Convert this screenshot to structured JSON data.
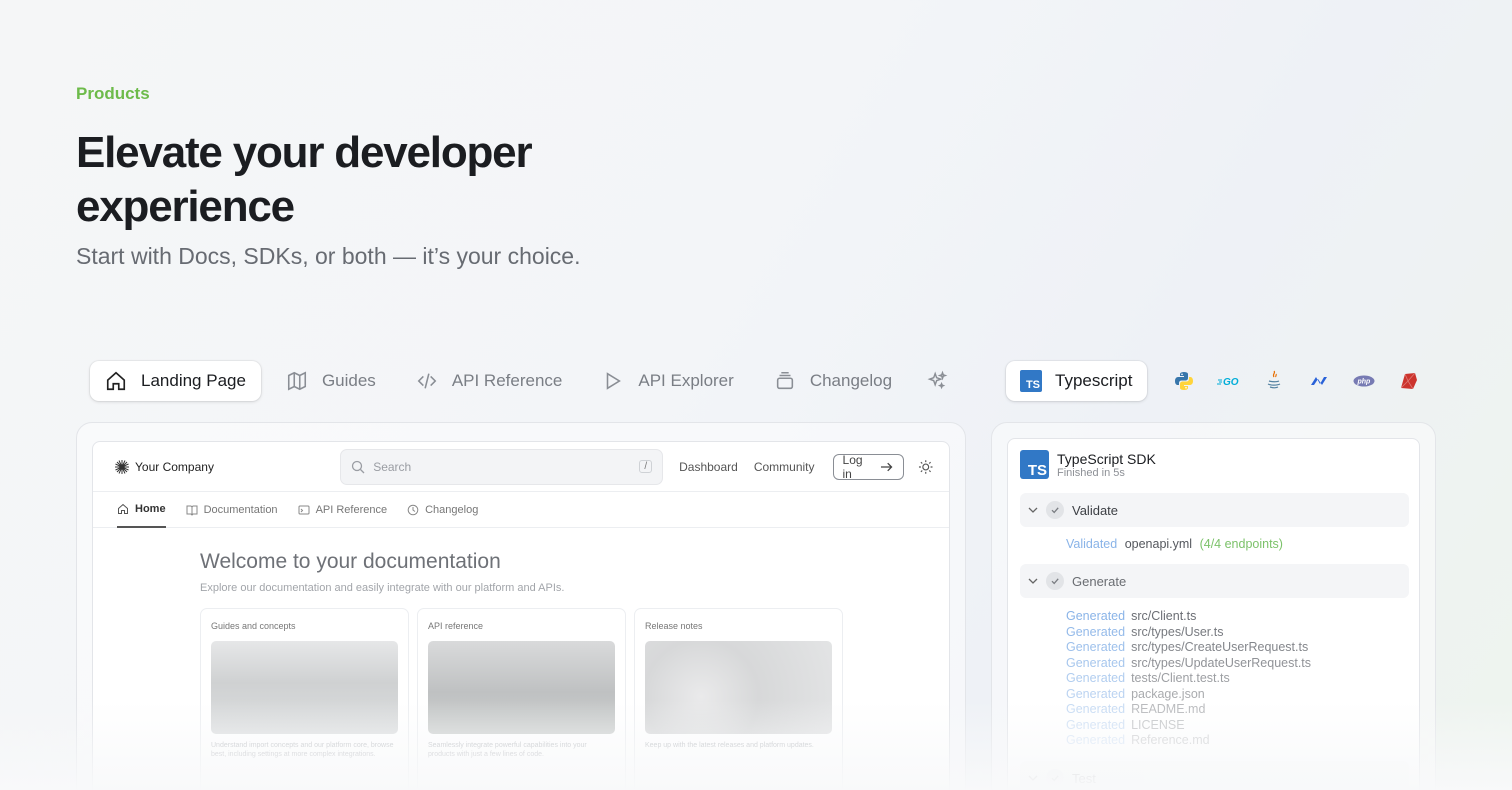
{
  "hero": {
    "eyebrow": "Products",
    "headline": "Elevate your developer experience",
    "subhead": "Start with Docs, SDKs, or both — it’s your choice."
  },
  "docs_tabs": [
    {
      "label": "Landing Page",
      "icon": "home-icon",
      "active": true
    },
    {
      "label": "Guides",
      "icon": "map-icon",
      "active": false
    },
    {
      "label": "API Reference",
      "icon": "code-icon",
      "active": false
    },
    {
      "label": "API Explorer",
      "icon": "play-icon",
      "active": false
    },
    {
      "label": "Changelog",
      "icon": "stack-icon",
      "active": false
    }
  ],
  "sdk_languages": {
    "active": "Typescript",
    "ts_badge": "TS",
    "others": [
      "python",
      "go",
      "java",
      "dotnet",
      "php",
      "ruby"
    ]
  },
  "preview": {
    "company": "Your Company",
    "search_placeholder": "Search",
    "search_shortcut": "/",
    "nav": [
      "Dashboard",
      "Community"
    ],
    "login": "Log in",
    "tabs": [
      "Home",
      "Documentation",
      "API Reference",
      "Changelog"
    ],
    "title": "Welcome to your documentation",
    "subtitle": "Explore our documentation and easily integrate with our platform and APIs.",
    "cards": [
      {
        "title": "Guides and concepts",
        "desc": "Understand import concepts and our platform core, browse best, including settings at more complex integrations."
      },
      {
        "title": "API reference",
        "desc": "Seamlessly integrate powerful capabilities into your products with just a few lines of code."
      },
      {
        "title": "Release notes",
        "desc": "Keep up with the latest releases and platform updates."
      }
    ]
  },
  "sdk_panel": {
    "badge": "TS",
    "name": "TypeScript SDK",
    "status": "Finished in 5s",
    "validate_step": "Validate",
    "validated_word": "Validated",
    "validated_file": "openapi.yml",
    "validated_count": "(4/4 endpoints)",
    "generate_step": "Generate",
    "generated_word": "Generated",
    "generated_files": [
      "src/Client.ts",
      "src/types/User.ts",
      "src/types/CreateUserRequest.ts",
      "src/types/UpdateUserRequest.ts",
      "tests/Client.test.ts",
      "package.json",
      "README.md",
      "LICENSE",
      "Reference.md"
    ],
    "next_step": "Test"
  },
  "colors": {
    "accent_green": "#6dbb4a",
    "ts_blue": "#3178c6",
    "generated_blue": "#8ab4e8"
  }
}
